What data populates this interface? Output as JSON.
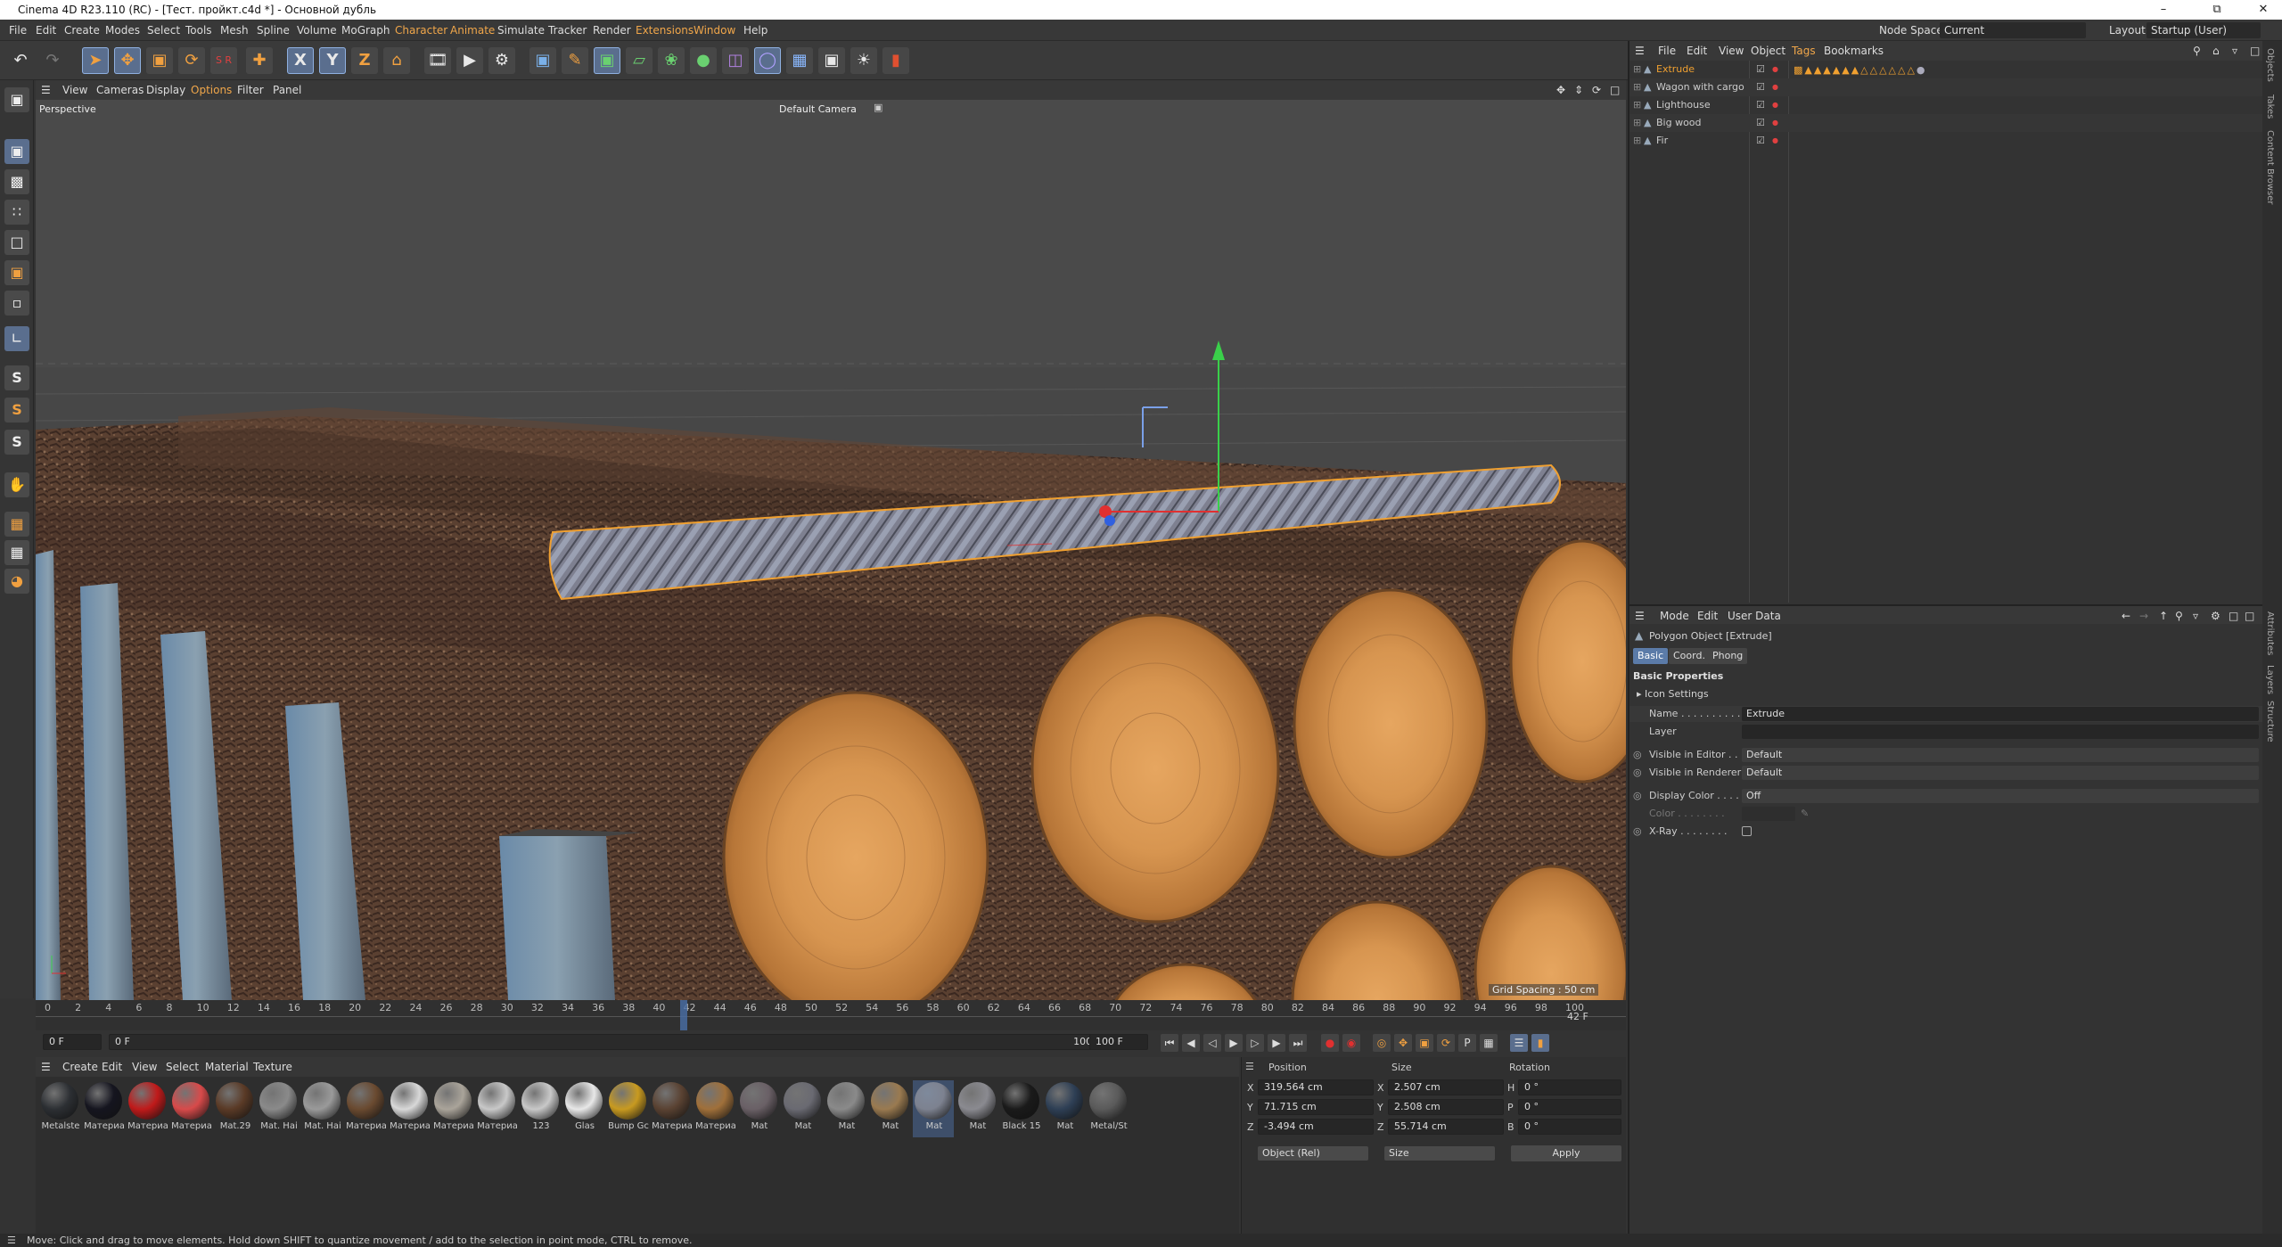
{
  "window": {
    "title": "Cinema 4D R23.110 (RC) - [Тест. пройкт.c4d *] - Основной дубль"
  },
  "menu": {
    "items": [
      "File",
      "Edit",
      "Create",
      "Modes",
      "Select",
      "Tools",
      "Mesh",
      "Spline",
      "Volume",
      "MoGraph",
      "Character",
      "Animate",
      "Simulate",
      "Tracker",
      "Render",
      "Extensions",
      "Window",
      "Help"
    ],
    "node_space_label": "Node Space:",
    "node_space_value": "Current (Standard/Physical)",
    "layout_label": "Layout:",
    "layout_value": "Startup (User)"
  },
  "viewport": {
    "menu": [
      "View",
      "Cameras",
      "Display",
      "Options",
      "Filter",
      "Panel"
    ],
    "view_name": "Perspective",
    "camera": "Default Camera",
    "grid_spacing": "Grid Spacing : 50 cm"
  },
  "timeline": {
    "ticks": [
      "0",
      "2",
      "4",
      "6",
      "8",
      "10",
      "12",
      "14",
      "16",
      "18",
      "20",
      "22",
      "24",
      "26",
      "28",
      "30",
      "32",
      "34",
      "36",
      "38",
      "40",
      "42",
      "44",
      "46",
      "48",
      "50",
      "52",
      "54",
      "56",
      "58",
      "60",
      "62",
      "64",
      "66",
      "68",
      "70",
      "72",
      "74",
      "76",
      "78",
      "80",
      "82",
      "84",
      "86",
      "88",
      "90",
      "92",
      "94",
      "96",
      "98",
      "100"
    ],
    "current_frame": "42 F",
    "start": "0 F",
    "min": "0 F",
    "max": "100 F",
    "end": "100 F"
  },
  "materials": {
    "menu": [
      "Create",
      "Edit",
      "View",
      "Select",
      "Material",
      "Texture"
    ],
    "items": [
      {
        "label": "Metalste",
        "color": "#2c2f33"
      },
      {
        "label": "Материа",
        "color": "#15151f"
      },
      {
        "label": "Материа",
        "color": "#c01a1a"
      },
      {
        "label": "Материа",
        "color": "#d84a4a"
      },
      {
        "label": "Mat.29",
        "color": "#5a3a26"
      },
      {
        "label": "Mat. Hai",
        "color": "#8a8a8a"
      },
      {
        "label": "Mat. Hai",
        "color": "#9a9a9a"
      },
      {
        "label": "Материа",
        "color": "#6a4a30"
      },
      {
        "label": "Материа",
        "color": "#d8d8d8"
      },
      {
        "label": "Материа",
        "color": "#aaa49a"
      },
      {
        "label": "Материа",
        "color": "#c8c8c8"
      },
      {
        "label": "123",
        "color": "#c8c8c8"
      },
      {
        "label": "Glas",
        "color": "#e8e8e8"
      },
      {
        "label": "Bump Gc",
        "color": "#c89a20"
      },
      {
        "label": "Материа",
        "color": "#5a4232"
      },
      {
        "label": "Материа",
        "color": "#a0703a"
      },
      {
        "label": "Mat",
        "color": "#6a6066"
      },
      {
        "label": "Mat",
        "color": "#6a6a72"
      },
      {
        "label": "Mat",
        "color": "#8a8a8a"
      },
      {
        "label": "Mat",
        "color": "#9a7a50"
      },
      {
        "label": "Mat",
        "color": "#7d8290"
      },
      {
        "label": "Mat",
        "color": "#8a8a90"
      },
      {
        "label": "Black 15",
        "color": "#1a1a1a"
      },
      {
        "label": "Mat",
        "color": "#2e3f55"
      },
      {
        "label": "Metal/St",
        "color": "#5a5a5a"
      }
    ]
  },
  "coords": {
    "headers": [
      "Position",
      "Size",
      "Rotation"
    ],
    "rows": [
      {
        "axis": "X",
        "pos": "319.564 cm",
        "size_axis": "X",
        "size": "2.507 cm",
        "rot_axis": "H",
        "rot": "0 °"
      },
      {
        "axis": "Y",
        "pos": "71.715 cm",
        "size_axis": "Y",
        "size": "2.508 cm",
        "rot_axis": "P",
        "rot": "0 °"
      },
      {
        "axis": "Z",
        "pos": "-3.494 cm",
        "size_axis": "Z",
        "size": "55.714 cm",
        "rot_axis": "B",
        "rot": "0 °"
      }
    ],
    "mode": "Object (Rel)",
    "size_mode": "Size",
    "apply": "Apply"
  },
  "objects": {
    "menu": [
      "File",
      "Edit",
      "View",
      "Object",
      "Tags",
      "Bookmarks"
    ],
    "list": [
      {
        "name": "Extrude",
        "color": "#f0a030"
      },
      {
        "name": "Wagon with cargo",
        "color": "#cccccc"
      },
      {
        "name": "Lighthouse",
        "color": "#cccccc"
      },
      {
        "name": "Big wood",
        "color": "#cccccc"
      },
      {
        "name": "Fir",
        "color": "#cccccc"
      }
    ]
  },
  "attributes": {
    "menu": [
      "Mode",
      "Edit",
      "User Data"
    ],
    "object_type": "Polygon Object [Extrude]",
    "tabs": [
      "Basic",
      "Coord.",
      "Phong"
    ],
    "section": "Basic Properties",
    "icon_settings": "Icon Settings",
    "fields": [
      {
        "label": "Name . . . . . . . . . .",
        "value": "Extrude"
      },
      {
        "label": "Layer",
        "value": ""
      },
      {
        "label": "Visible in Editor . . .",
        "value": "Default"
      },
      {
        "label": "Visible in Renderer",
        "value": "Default"
      },
      {
        "label": "Display Color . . . .",
        "value": "Off"
      },
      {
        "label": "Color . . . . . . . .",
        "value": ""
      },
      {
        "label": "X-Ray . . . . . . . .",
        "value": ""
      }
    ]
  },
  "side_tabs": [
    "Objects",
    "Takes",
    "Content Browser",
    "Attributes",
    "Layers",
    "Structure"
  ],
  "status": "Move: Click and drag to move elements. Hold down SHIFT to quantize movement / add to the selection in point mode, CTRL to remove."
}
